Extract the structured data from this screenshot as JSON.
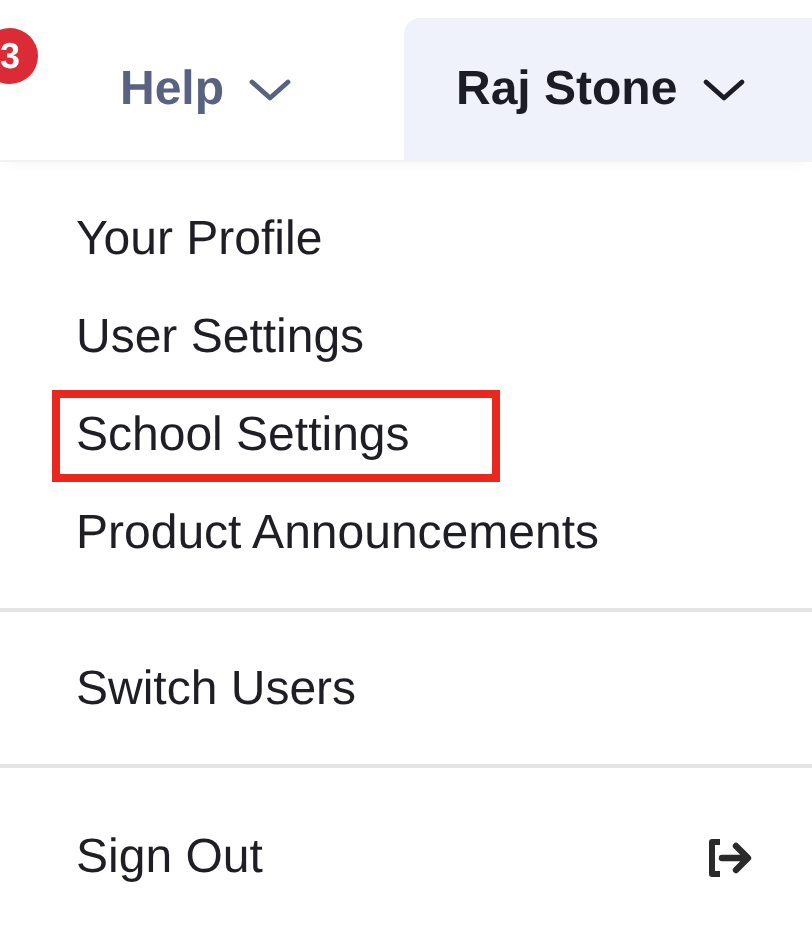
{
  "header": {
    "badge": "3",
    "help": {
      "label": "Help"
    },
    "user_menu": {
      "label": "Raj Stone",
      "expanded": true
    }
  },
  "menu": {
    "sections": [
      {
        "items": [
          {
            "label": "Your Profile",
            "kind": "link",
            "highlighted": false
          },
          {
            "label": "User Settings",
            "kind": "link",
            "highlighted": false
          },
          {
            "label": "School Settings",
            "kind": "link",
            "highlighted": true
          },
          {
            "label": "Product Announcements",
            "kind": "link",
            "highlighted": false
          }
        ]
      },
      {
        "items": [
          {
            "label": "Switch Users",
            "kind": "link",
            "highlighted": false
          }
        ]
      },
      {
        "items": [
          {
            "label": "Sign Out",
            "kind": "sign-out",
            "highlighted": false
          }
        ]
      }
    ]
  }
}
